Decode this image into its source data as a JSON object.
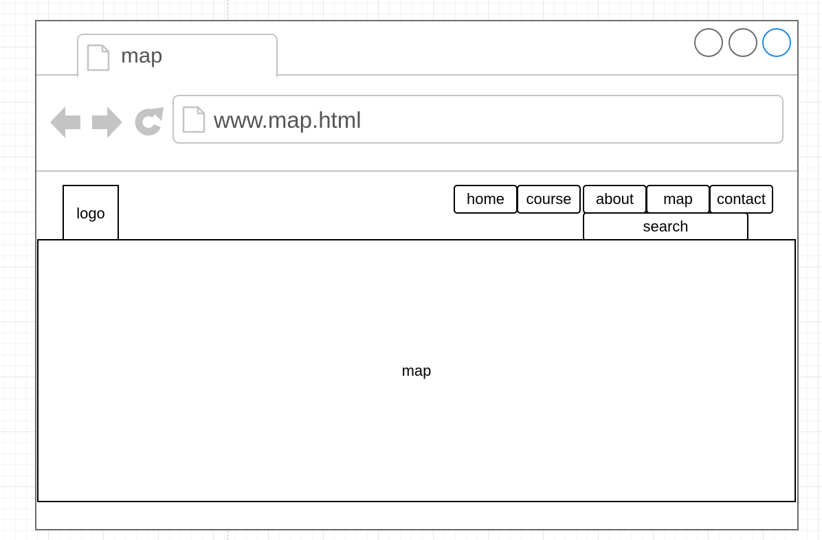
{
  "browser": {
    "tab_title": "map",
    "address_url": "www.map.html",
    "icons": {
      "tab": "document-icon",
      "back": "back-arrow-icon",
      "forward": "forward-arrow-icon",
      "reload": "reload-icon",
      "address": "document-icon"
    },
    "window_controls": [
      "minimize",
      "maximize",
      "close"
    ],
    "colors": {
      "frame": "#6b6b6b",
      "chrome": "#c4c4c4",
      "text": "#555555",
      "close_accent": "#1e8ae6"
    }
  },
  "page": {
    "logo_label": "logo",
    "nav_items": [
      "home",
      "course",
      "about",
      "map",
      "contact"
    ],
    "search_label": "search",
    "content_label": "map"
  }
}
